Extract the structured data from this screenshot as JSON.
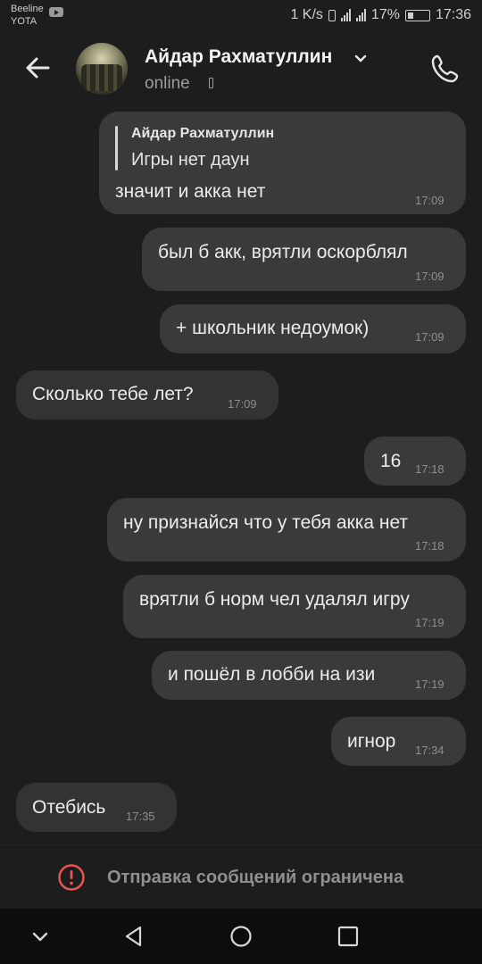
{
  "status_bar": {
    "carrier_1": "Beeline",
    "carrier_2": "YOTA",
    "speed": "1 K/s",
    "battery": "17%",
    "time": "17:36"
  },
  "header": {
    "contact_name": "Айдар Рахматуллин",
    "status": "online"
  },
  "messages": [
    {
      "direction": "outgoing",
      "reply_to": {
        "name": "Айдар Рахматуллин",
        "text": "Игры нет даун"
      },
      "text": "значит и акка нет",
      "time": "17:09"
    },
    {
      "direction": "outgoing",
      "text": "был б акк, врятли оскорблял",
      "time": "17:09"
    },
    {
      "direction": "outgoing",
      "text": "+ школьник недоумок)",
      "time": "17:09"
    },
    {
      "direction": "incoming",
      "text": "Сколько тебе лет?",
      "time": "17:09"
    },
    {
      "direction": "outgoing",
      "text": "16",
      "time": "17:18"
    },
    {
      "direction": "outgoing",
      "text": "ну признайся что у тебя акка нет",
      "time": "17:18"
    },
    {
      "direction": "outgoing",
      "text": "врятли б норм чел удалял игру",
      "time": "17:19"
    },
    {
      "direction": "outgoing",
      "text": "и пошёл в лобби на изи",
      "time": "17:19"
    },
    {
      "direction": "outgoing",
      "text": "игнор",
      "time": "17:34"
    },
    {
      "direction": "incoming",
      "text": "Отебись",
      "time": "17:35"
    }
  ],
  "restriction_notice": "Отправка сообщений ограничена",
  "icons": {
    "back": "arrow-left-icon",
    "dropdown": "chevron-down-icon",
    "device": "phone-device-icon",
    "call": "phone-call-icon",
    "warning": "exclamation-circle-icon",
    "nav": [
      "chevron-down-icon",
      "back-triangle-icon",
      "home-circle-icon",
      "recents-square-icon"
    ]
  },
  "colors": {
    "background": "#1d1d1d",
    "bubble": "#3a3a3a",
    "warning_red": "#e8564f",
    "muted_text": "#8f8f8f"
  }
}
